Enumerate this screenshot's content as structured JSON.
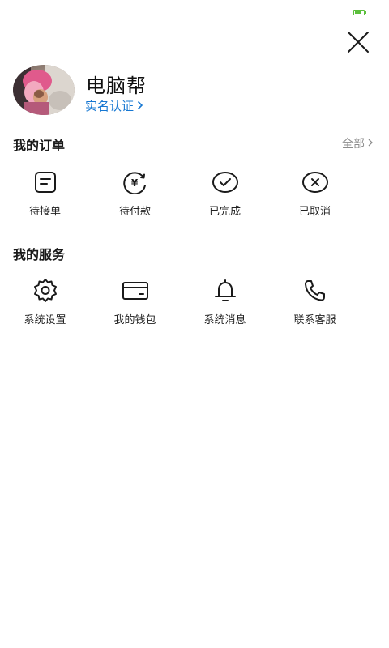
{
  "status_bar": {
    "battery_color": "#5bbf3c"
  },
  "close": {
    "icon": "close-icon"
  },
  "profile": {
    "username": "电脑帮",
    "verify_label": "实名认证",
    "verify_color": "#1677d2"
  },
  "orders": {
    "title": "我的订单",
    "see_all": "全部",
    "items": [
      {
        "label": "待接单",
        "icon": "document-list-icon"
      },
      {
        "label": "待付款",
        "icon": "yuan-payment-icon"
      },
      {
        "label": "已完成",
        "icon": "check-circle-icon"
      },
      {
        "label": "已取消",
        "icon": "cancel-circle-icon"
      }
    ]
  },
  "services": {
    "title": "我的服务",
    "items": [
      {
        "label": "系统设置",
        "icon": "gear-icon"
      },
      {
        "label": "我的钱包",
        "icon": "wallet-card-icon"
      },
      {
        "label": "系统消息",
        "icon": "bell-icon"
      },
      {
        "label": "联系客服",
        "icon": "phone-icon"
      }
    ]
  }
}
